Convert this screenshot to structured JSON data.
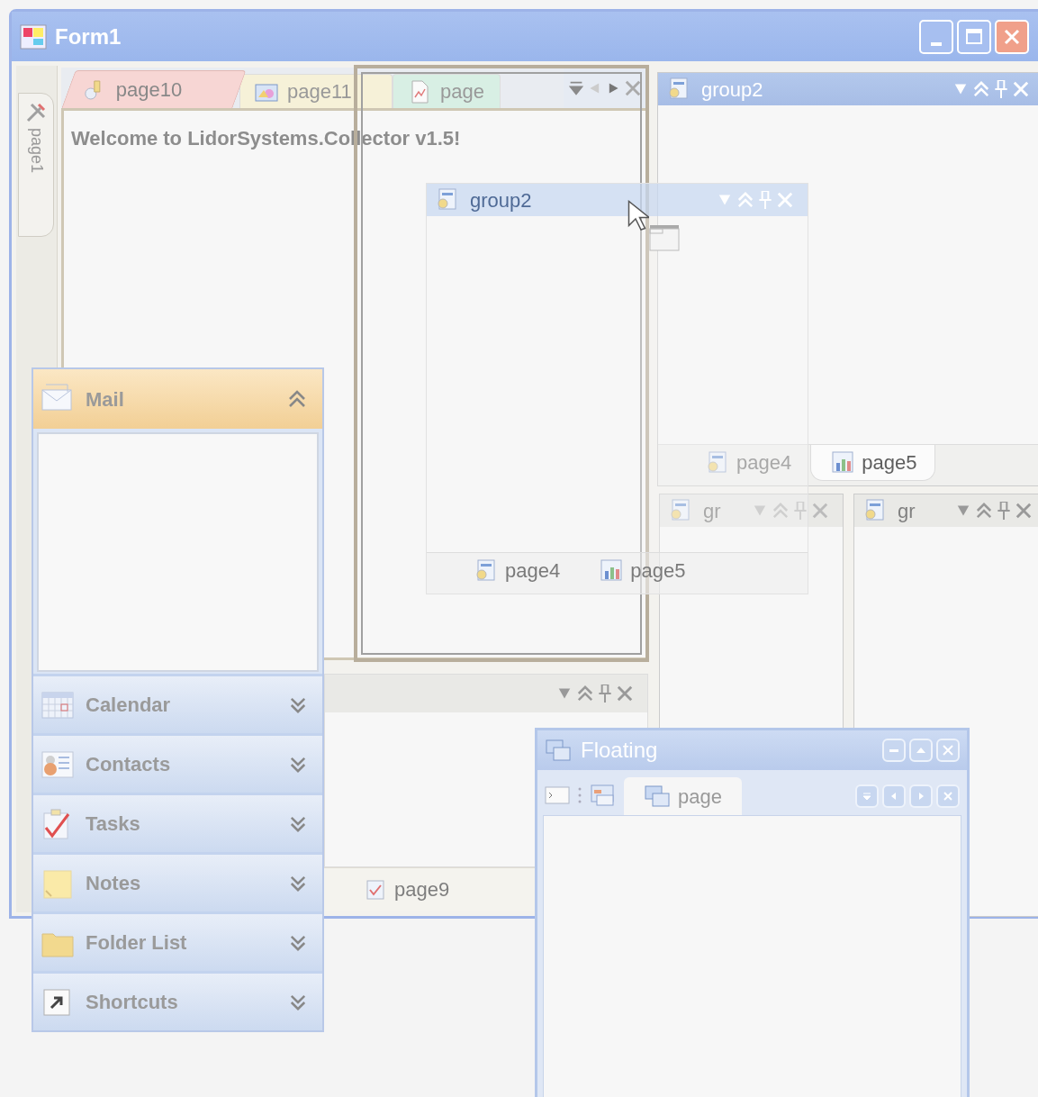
{
  "window": {
    "title": "Form1"
  },
  "side_tabs": [
    {
      "label": "page1",
      "selected": false
    }
  ],
  "document_group": {
    "tabs": [
      {
        "label": "page10",
        "selected": true,
        "color": "#f7d6d4"
      },
      {
        "label": "page11",
        "selected": false,
        "color": "#f6f1d8"
      },
      {
        "label": "page",
        "selected": false,
        "color": "#d8efe4"
      }
    ],
    "content_text": "Welcome to LidorSystems.Collector v1.5!"
  },
  "group_panel": {
    "title": "group2",
    "tabs": [
      {
        "label": "page4",
        "selected": false
      },
      {
        "label": "page5",
        "selected": true
      }
    ]
  },
  "small_panels": [
    {
      "title": "gr"
    },
    {
      "title": "gr"
    }
  ],
  "dragged_panel": {
    "title": "group2",
    "tabs": [
      {
        "label": "page4",
        "selected": false
      },
      {
        "label": "page5",
        "selected": false
      }
    ]
  },
  "bottom_panel": {
    "tabs": [
      {
        "label": "page9",
        "selected": false
      }
    ]
  },
  "outlook_bar": {
    "items": [
      {
        "label": "Mail",
        "expanded": true
      },
      {
        "label": "Calendar",
        "expanded": false
      },
      {
        "label": "Contacts",
        "expanded": false
      },
      {
        "label": "Tasks",
        "expanded": false
      },
      {
        "label": "Notes",
        "expanded": false
      },
      {
        "label": "Folder List",
        "expanded": false
      },
      {
        "label": "Shortcuts",
        "expanded": false
      }
    ]
  },
  "floating_window": {
    "title": "Floating",
    "tabs": [
      {
        "label": "page",
        "selected": true
      }
    ]
  }
}
